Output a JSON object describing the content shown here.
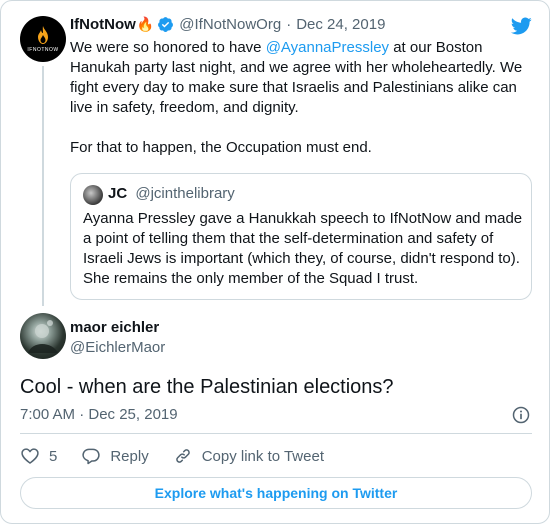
{
  "parent_tweet": {
    "name": "IfNotNow",
    "name_emoji": "🔥",
    "handle": "@IfNotNowOrg",
    "date": "Dec 24, 2019",
    "avatar_text": "IFNOTNOW",
    "text_before_mention": "We were so honored to have ",
    "mention": "@AyannaPressley",
    "text_after_mention": " at our Boston Hanukah party last night, and we agree with her wholeheartedly. We fight every day to make sure that Israelis and Palestinians alike can live in safety, freedom, and dignity.",
    "text_second_paragraph": "For that to happen, the Occupation must end."
  },
  "quoted_tweet": {
    "name": "JC",
    "handle": "@jcinthelibrary",
    "text": "Ayanna Pressley gave a Hanukkah speech to IfNotNow and made a point of telling them that the self-determination and safety of Israeli Jews is important (which they, of course, didn't respond to). She remains the only member of the Squad I trust."
  },
  "main_tweet": {
    "name": "maor eichler",
    "handle": "@EichlerMaor",
    "text": "Cool - when are the Palestinian elections?",
    "timestamp": "7:00 AM · Dec 25, 2019"
  },
  "actions": {
    "like_count": "5",
    "reply_label": "Reply",
    "copy_link_label": "Copy link to Tweet"
  },
  "explore_label": "Explore what's happening on Twitter",
  "colors": {
    "accent": "#1d9bf0",
    "text": "#0f1419",
    "secondary": "#536471",
    "border": "#cfd9de"
  }
}
